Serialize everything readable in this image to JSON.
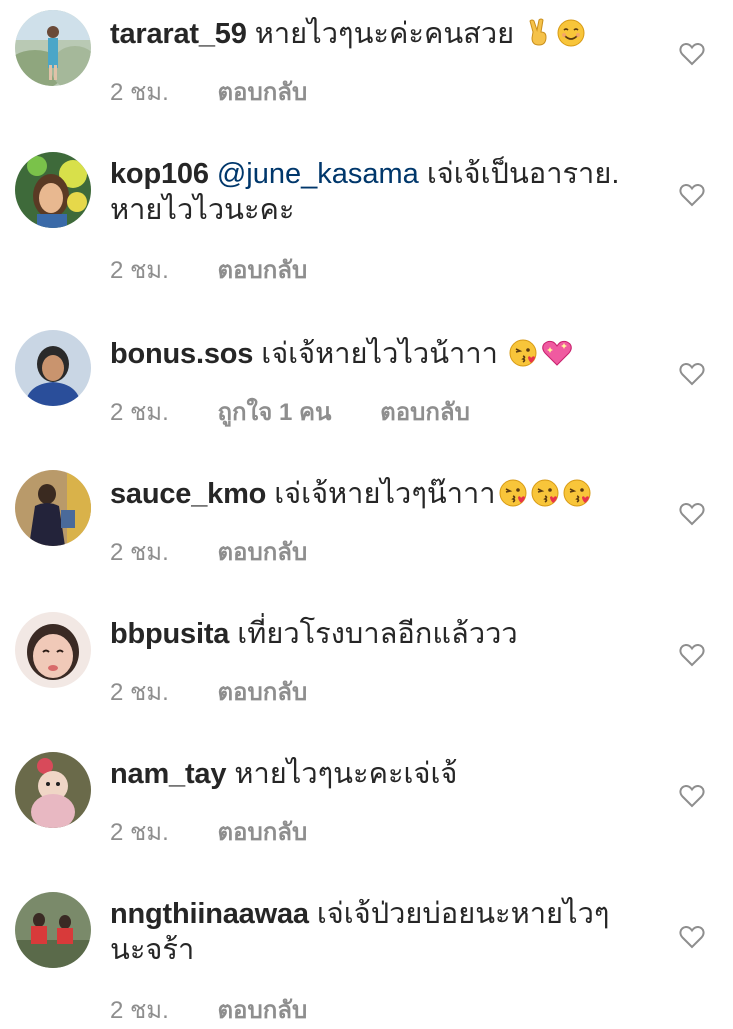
{
  "comments": [
    {
      "username": "tararat_59",
      "mention": "",
      "text": "หายไวๆนะค่ะคนสวย",
      "emojis": [
        "victory-hand-emoji",
        "smiling-face-emoji"
      ],
      "time": "2 ชม.",
      "likes": "",
      "reply": "ตอบกลับ"
    },
    {
      "username": "kop106",
      "mention": "@june_kasama",
      "text": "เจ่เจ้เป็นอาราย.",
      "text2": "หายไวไวนะคะ",
      "emojis": [],
      "time": "2 ชม.",
      "likes": "",
      "reply": "ตอบกลับ"
    },
    {
      "username": "bonus.sos",
      "mention": "",
      "text": "เจ่เจ้หายไวไวน้าาา",
      "emojis": [
        "kissing-face-emoji",
        "sparkling-heart-emoji"
      ],
      "time": "2 ชม.",
      "likes": "ถูกใจ 1 คน",
      "reply": "ตอบกลับ"
    },
    {
      "username": "sauce_kmo",
      "mention": "",
      "text": "เจ่เจ้หายไวๆน๊าาา",
      "emojis": [
        "kissing-face-emoji",
        "kissing-face-emoji",
        "kissing-face-emoji"
      ],
      "time": "2 ชม.",
      "likes": "",
      "reply": "ตอบกลับ"
    },
    {
      "username": "bbpusita",
      "mention": "",
      "text": "เที่ยวโรงบาลอีกแล้ววว",
      "emojis": [],
      "time": "2 ชม.",
      "likes": "",
      "reply": "ตอบกลับ"
    },
    {
      "username": "nam_tay",
      "mention": "",
      "text": "หายไวๆนะคะเจ่เจ้",
      "emojis": [],
      "time": "2 ชม.",
      "likes": "",
      "reply": "ตอบกลับ"
    },
    {
      "username": "nngthiinaawaa",
      "mention": "",
      "text": "เจ่เจ้ป่วยบ่อยนะหายไวๆ",
      "text2": "นะจร้า",
      "emojis": [],
      "time": "2 ชม.",
      "likes": "",
      "reply": "ตอบกลับ"
    }
  ],
  "colors": {
    "text": "#262626",
    "meta": "#8e8e8e",
    "mention": "#00376b",
    "heart": "#8e8e8e"
  }
}
